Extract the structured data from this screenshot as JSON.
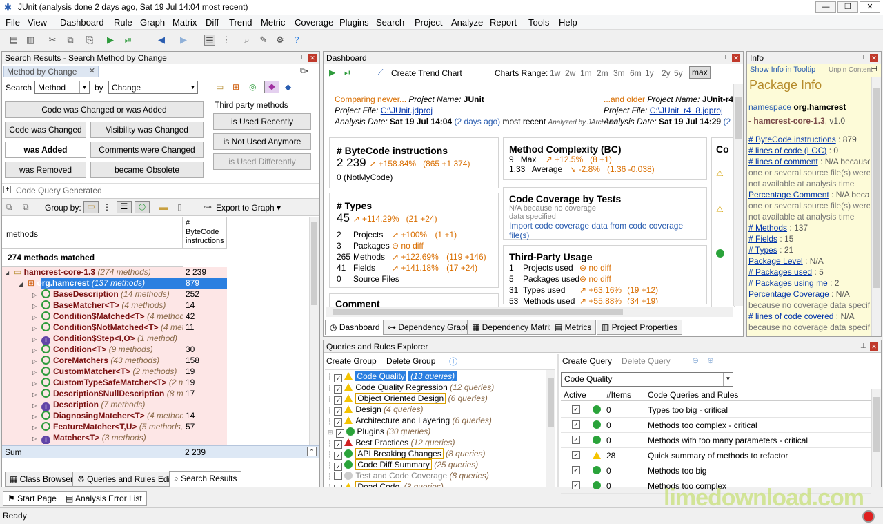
{
  "window": {
    "title": "JUnit  (analysis done 2 days ago, Sat 19 Jul  14:04 most recent)"
  },
  "menu": [
    "File",
    "View",
    "Dashboard",
    "Rule",
    "Graph",
    "Matrix",
    "Diff",
    "Trend",
    "Metric",
    "Coverage",
    "Plugins",
    "Search",
    "Project",
    "Analyze",
    "Report",
    "Tools",
    "Help"
  ],
  "search": {
    "panel_title": "Search Results - Search Method by Change",
    "tab_label": "Method by Change",
    "search_label": "Search",
    "search_value": "Method",
    "by_label": "by",
    "by_value": "Change",
    "buttons": {
      "changed_or_added": "Code was Changed or was Added",
      "changed": "Code was Changed",
      "visibility": "Visibility was Changed",
      "added": "was Added",
      "comments": "Comments were Changed",
      "removed": "was Removed",
      "obsolete": "became Obsolete"
    },
    "third_party": {
      "label": "Third party methods",
      "recently": "is Used Recently",
      "not_used": "is Not Used Anymore",
      "differently": "is Used Differently"
    },
    "cqg": "Code Query Generated",
    "group_by": "Group by:",
    "export": "Export to Graph",
    "col_methods": "methods",
    "col_bytecode": "# ByteCode instructions",
    "matched": "274 methods matched",
    "rows": [
      {
        "name": "hamcrest-core-1.3",
        "count": "(274 methods)",
        "val": "2 239"
      },
      {
        "name": "org.hamcrest",
        "count": "(137 methods)",
        "val": "879"
      },
      {
        "name": "BaseDescription",
        "count": "(14 methods)",
        "val": "252"
      },
      {
        "name": "BaseMatcher<T>",
        "count": "(4 methods)",
        "val": "14"
      },
      {
        "name": "Condition$Matched<T>",
        "count": "(4 methods)",
        "val": "42"
      },
      {
        "name": "Condition$NotMatched<T>",
        "count": "(4 met",
        "val": "11"
      },
      {
        "name": "Condition$Step<I,O>",
        "count": "(1 method)",
        "val": ""
      },
      {
        "name": "Condition<T>",
        "count": "(9 methods)",
        "val": "30"
      },
      {
        "name": "CoreMatchers",
        "count": "(43 methods)",
        "val": "158"
      },
      {
        "name": "CustomMatcher<T>",
        "count": "(2 methods)",
        "val": "19"
      },
      {
        "name": "CustomTypeSafeMatcher<T>",
        "count": "(2 m",
        "val": "19"
      },
      {
        "name": "Description$NullDescription",
        "count": "(8 me",
        "val": "17"
      },
      {
        "name": "Description",
        "count": "(7 methods)",
        "val": ""
      },
      {
        "name": "DiagnosingMatcher<T>",
        "count": "(4 method",
        "val": "14"
      },
      {
        "name": "FeatureMatcher<T,U>",
        "count": "(5 methods,",
        "val": "57"
      },
      {
        "name": "Matcher<T>",
        "count": "(3 methods)",
        "val": ""
      }
    ],
    "sum_label": "Sum",
    "sum_val": "2 239",
    "bottom_tabs": [
      "Class Browser",
      "Queries and Rules Edit",
      "Search Results"
    ]
  },
  "dashboard": {
    "title": "Dashboard",
    "create_trend": "Create Trend Chart",
    "range_label": "Charts Range:",
    "ranges": [
      "1w",
      "2w",
      "1m",
      "2m",
      "3m",
      "6m",
      "1y",
      "2y",
      "5y",
      "max"
    ],
    "cmp_newer": "Comparing newer...",
    "proj_name_label": "Project Name:",
    "proj_new": "JUnit",
    "proj_file_label": "Project File:",
    "file_new": "C:\\JUnit.jdproj",
    "date_label": "Analysis Date:",
    "date_new": "Sat 19 Jul  14:04",
    "ago_new": "(2 days ago)",
    "most_recent": "most recent",
    "analyzed_by": "Analyzed by JArchitect",
    "cmp_older": "...and older",
    "proj_old": "JUnit-r4.8",
    "file_old": "C:\\JUnit_r4_8.jdproj",
    "date_old": "Sat 19 Jul  14:29",
    "ago_old": "(2 days a",
    "bytecode": {
      "title": "# ByteCode instructions",
      "value": "2 239",
      "pct": "+158.84%",
      "delta": "(865 +1 374)",
      "notmycode": "0  (NotMyCode)"
    },
    "complexity": {
      "title": "Method Complexity (BC)",
      "max_v": "9",
      "max_l": "Max",
      "max_pct": "+12.5%",
      "max_d": "(8 +1)",
      "avg_v": "1.33",
      "avg_l": "Average",
      "avg_pct": "-2.8%",
      "avg_d": "(1.36 -0.038)"
    },
    "types": {
      "title": "# Types",
      "value": "45",
      "pct": "+114.29%",
      "delta": "(21 +24)",
      "rows": [
        {
          "v": "2",
          "l": "Projects",
          "p": "+100%",
          "d": "(1 +1)"
        },
        {
          "v": "3",
          "l": "Packages",
          "p": "no diff",
          "d": ""
        },
        {
          "v": "265",
          "l": "Methods",
          "p": "+122.69%",
          "d": "(119 +146)"
        },
        {
          "v": "41",
          "l": "Fields",
          "p": "+141.18%",
          "d": "(17 +24)"
        },
        {
          "v": "0",
          "l": "Source Files",
          "p": "",
          "d": ""
        }
      ]
    },
    "coverage": {
      "title": "Code Coverage by Tests",
      "na1": "N/A because no coverage",
      "na2": "data specified",
      "import": "Import code coverage data from code coverage file(s)"
    },
    "third": {
      "title": "Third-Party Usage",
      "rows": [
        {
          "v": "1",
          "l": "Projects used",
          "p": "no diff",
          "d": ""
        },
        {
          "v": "5",
          "l": "Packages used",
          "p": "no diff",
          "d": ""
        },
        {
          "v": "31",
          "l": "Types used",
          "p": "+63.16%",
          "d": "(19 +12)"
        },
        {
          "v": "53",
          "l": "Methods used",
          "p": "+55.88%",
          "d": "(34 +19)"
        }
      ]
    },
    "comment_title": "Comment",
    "co_title": "Co",
    "tabs": [
      "Dashboard",
      "Dependency Graph",
      "Dependency Matrix",
      "Metrics",
      "Project Properties"
    ]
  },
  "info": {
    "title": "Info",
    "show_tooltip": "Show Info in Tooltip",
    "unpin": "Unpin Content",
    "heading": "Package Info",
    "ns_label": "namespace",
    "ns": "org.hamcrest",
    "asm": "- hamcrest-core-1.3",
    "ver": ", v1.0",
    "lines": [
      {
        "k": "# ByteCode instructions",
        "v": "879"
      },
      {
        "k": "# lines of code (LOC)",
        "v": "0"
      },
      {
        "k": "# lines of comment",
        "v": "N/A because"
      },
      {
        "k": "",
        "v": "one or several source file(s) were"
      },
      {
        "k": "",
        "v": "not available at analysis time"
      },
      {
        "k": "Percentage Comment",
        "v": "N/A because"
      },
      {
        "k": "",
        "v": "one or several source file(s) were"
      },
      {
        "k": "",
        "v": "not available at analysis time"
      },
      {
        "k": "# Methods",
        "v": "137"
      },
      {
        "k": "# Fields",
        "v": "15"
      },
      {
        "k": "# Types",
        "v": "21"
      },
      {
        "k": "Package Level",
        "v": "N/A"
      },
      {
        "k": "# Packages used",
        "v": "5"
      },
      {
        "k": "# Packages using me",
        "v": "2"
      },
      {
        "k": "Percentage Coverage",
        "v": "N/A"
      },
      {
        "k": "",
        "v": "because no coverage data specified"
      },
      {
        "k": "# lines of code covered",
        "v": "N/A"
      },
      {
        "k": "",
        "v": "because no coverage data specified"
      }
    ]
  },
  "queries": {
    "title": "Queries and Rules Explorer",
    "create_group": "Create Group",
    "delete_group": "Delete Group",
    "groups": [
      {
        "name": "Code Quality",
        "count": "(13 queries)",
        "state": "warn",
        "style": "hl"
      },
      {
        "name": "Code Quality Regression",
        "count": "(12 queries)",
        "state": "warn",
        "style": ""
      },
      {
        "name": "Object Oriented Design",
        "count": "(6 queries)",
        "state": "warn",
        "style": "box"
      },
      {
        "name": "Design",
        "count": "(4 queries)",
        "state": "warn",
        "style": ""
      },
      {
        "name": "Architecture and Layering",
        "count": "(6 queries)",
        "state": "warn",
        "style": ""
      },
      {
        "name": "Plugins",
        "count": "(30 queries)",
        "state": "ok",
        "style": ""
      },
      {
        "name": "Best Practices",
        "count": "(12 queries)",
        "state": "err",
        "style": ""
      },
      {
        "name": "API Breaking Changes",
        "count": "(8 queries)",
        "state": "ok",
        "style": "box"
      },
      {
        "name": "Code Diff Summary",
        "count": "(25 queries)",
        "state": "ok",
        "style": "box"
      },
      {
        "name": "Test and Code Coverage",
        "count": "(8 queries)",
        "state": "off",
        "style": "dis"
      },
      {
        "name": "Dead Code",
        "count": "(3 queries)",
        "state": "warn",
        "style": "box"
      }
    ],
    "create_query": "Create Query",
    "delete_query": "Delete Query",
    "selected_group": "Code Quality",
    "cols": {
      "active": "Active",
      "items": "#Items",
      "rules": "Code Queries and Rules"
    },
    "rules": [
      {
        "items": "0",
        "state": "ok",
        "name": "Types too big - critical"
      },
      {
        "items": "0",
        "state": "ok",
        "name": "Methods too complex - critical"
      },
      {
        "items": "0",
        "state": "ok",
        "name": "Methods with too many parameters - critical"
      },
      {
        "items": "28",
        "state": "warn",
        "name": "Quick summary of methods to refactor"
      },
      {
        "items": "0",
        "state": "ok",
        "name": "Methods too big"
      },
      {
        "items": "0",
        "state": "ok",
        "name": "Methods too complex"
      }
    ]
  },
  "bottom": {
    "tabs": [
      "Start Page",
      "Analysis Error List"
    ],
    "status": "Ready",
    "watermark": "limedownload.com"
  }
}
